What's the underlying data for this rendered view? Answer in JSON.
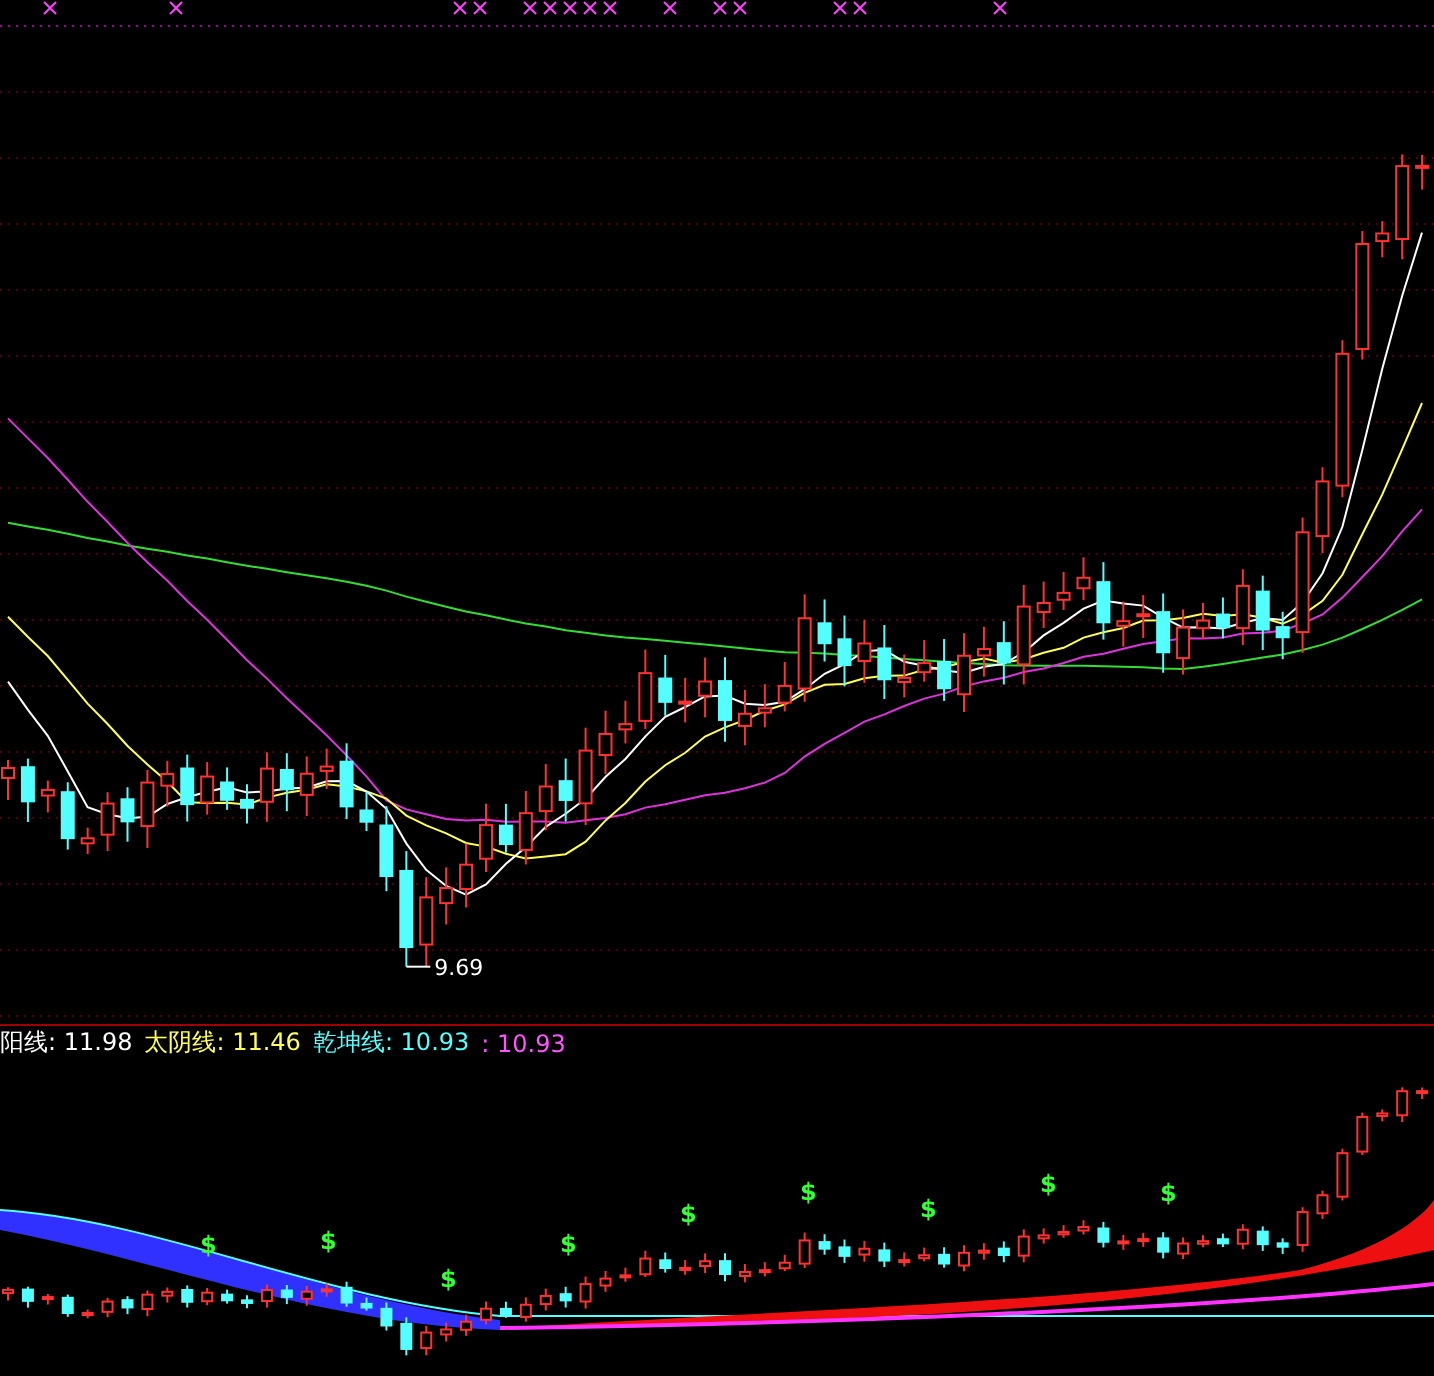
{
  "price_panel": {
    "low_marker": "9.69"
  },
  "indicator_panel": {
    "legend": [
      {
        "text": "阳线: 11.98",
        "color": "#ffffff"
      },
      {
        "text": "太阴线: 11.46",
        "color": "#ffff54"
      },
      {
        "text": "乾坤线: 10.93",
        "color": "#54ffff"
      },
      {
        "text": ": 10.93",
        "color": "#ff54ff"
      }
    ],
    "signals": [
      "$",
      "$",
      "$",
      "$",
      "$",
      "$",
      "$",
      "$",
      "$"
    ]
  }
}
